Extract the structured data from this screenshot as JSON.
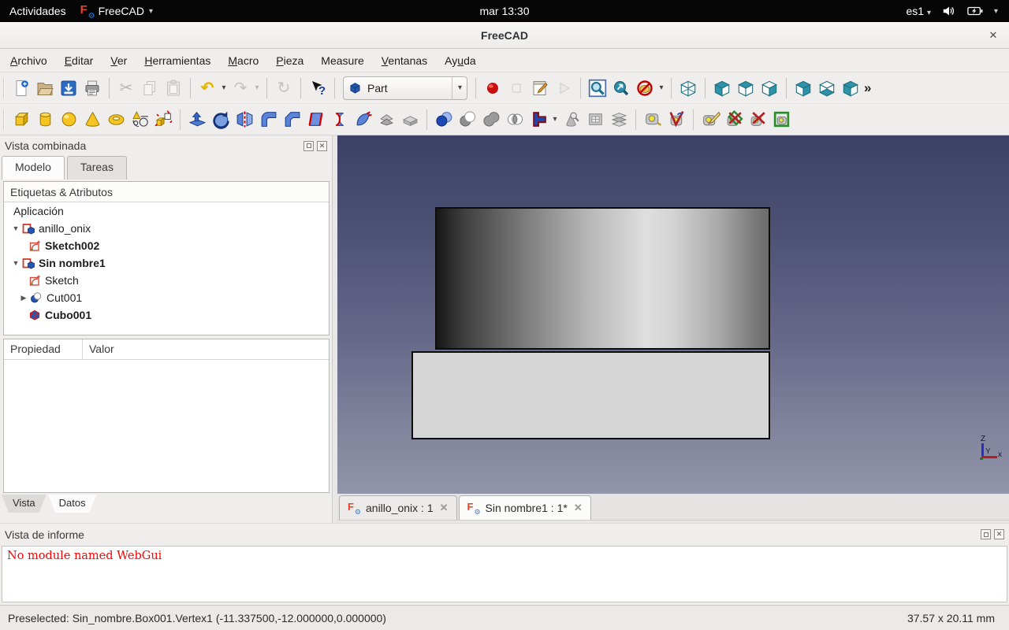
{
  "topbar": {
    "activities": "Actividades",
    "app_name": "FreeCAD",
    "clock": "mar 13:30",
    "keyboard_layout": "es1"
  },
  "titlebar": {
    "title": "FreeCAD"
  },
  "menubar": {
    "items": [
      {
        "label": "Archivo",
        "accel": 0
      },
      {
        "label": "Editar",
        "accel": 0
      },
      {
        "label": "Ver",
        "accel": 0
      },
      {
        "label": "Herramientas",
        "accel": 0
      },
      {
        "label": "Macro",
        "accel": 0
      },
      {
        "label": "Pieza",
        "accel": 0
      },
      {
        "label": "Measure",
        "accel": -1
      },
      {
        "label": "Ventanas",
        "accel": 0
      },
      {
        "label": "Ayuda",
        "accel": 2
      }
    ]
  },
  "toolbars": {
    "file": [
      "new-document",
      "open-document",
      "save-document",
      "print",
      "cut",
      "copy",
      "paste",
      "undo",
      "redo",
      "refresh",
      "whats-this"
    ],
    "macro": [
      "macro-record",
      "macro-stop",
      "macro-edit",
      "macro-run"
    ],
    "view": [
      "fit-all",
      "zoom-sync",
      "draw-style",
      "view-axonometric",
      "view-front",
      "view-top",
      "view-right",
      "view-rear",
      "view-bottom",
      "view-left"
    ],
    "part": [
      "box",
      "cylinder",
      "sphere",
      "cone",
      "torus",
      "primitives",
      "shape-builder",
      "extrude",
      "revolve",
      "mirror",
      "fillet",
      "chamfer",
      "make-face",
      "ruled-surface",
      "loft",
      "offset",
      "thickness",
      "boolean",
      "cut-boolean",
      "union",
      "intersection",
      "compound",
      "check-geometry",
      "box-section",
      "cross-sections",
      "measure-linear",
      "measure-angular",
      "measure-refresh",
      "measure-toggle-all",
      "measure-toggle-delta",
      "measure-clear-all"
    ]
  },
  "workbench": {
    "selected": "Part"
  },
  "icons": {
    "dropdown": "▾",
    "close": "✕",
    "overflow": "»",
    "undo": "↶",
    "redo": "↷",
    "refresh": "↻",
    "cut": "✂",
    "gear": "⚙",
    "logo_letter": "F",
    "expanded": "▼",
    "collapsed": "▶"
  },
  "combined_view": {
    "title": "Vista combinada",
    "tabs": [
      {
        "label": "Modelo"
      },
      {
        "label": "Tareas"
      }
    ],
    "tree": {
      "column_header": "Etiquetas & Atributos",
      "root": "Aplicación",
      "items": [
        {
          "label": "anillo_onix",
          "icon": "document",
          "bold": false,
          "state": "expanded"
        },
        {
          "label": "Sketch002",
          "icon": "sketch",
          "bold": true
        },
        {
          "label": "Sin nombre1",
          "icon": "document",
          "bold": true,
          "state": "expanded"
        },
        {
          "label": "Sketch",
          "icon": "sketch",
          "bold": false
        },
        {
          "label": "Cut001",
          "icon": "boolean-cut",
          "bold": false,
          "state": "collapsed"
        },
        {
          "label": "Cubo001",
          "icon": "box",
          "bold": true
        }
      ]
    },
    "property_editor": {
      "columns": [
        "Propiedad",
        "Valor"
      ],
      "rows": []
    },
    "bottom_tabs": [
      {
        "label": "Vista"
      },
      {
        "label": "Datos"
      }
    ]
  },
  "viewport": {
    "document_tabs": [
      {
        "label": "anillo_onix : 1",
        "active": false
      },
      {
        "label": "Sin nombre1 : 1*",
        "active": true
      }
    ],
    "axis_labels": {
      "x": "x",
      "y": "Y",
      "z": "Z"
    }
  },
  "report_view": {
    "title": "Vista de informe",
    "messages": [
      {
        "text": "No module named WebGui",
        "color": "#ff0000"
      }
    ]
  },
  "statusbar": {
    "left": "Preselected: Sin_nombre.Box001.Vertex1 (-11.337500,-12.000000,0.000000)",
    "right": "37.57 x 20.11 mm"
  },
  "colors": {
    "viewport_top": "#3c4065",
    "viewport_bottom": "#9294a9",
    "error_text": "#ff0000",
    "primitive_yellow": "#f6c524",
    "operation_blue": "#3b66c4",
    "accent_teal": "#2f93a8"
  }
}
